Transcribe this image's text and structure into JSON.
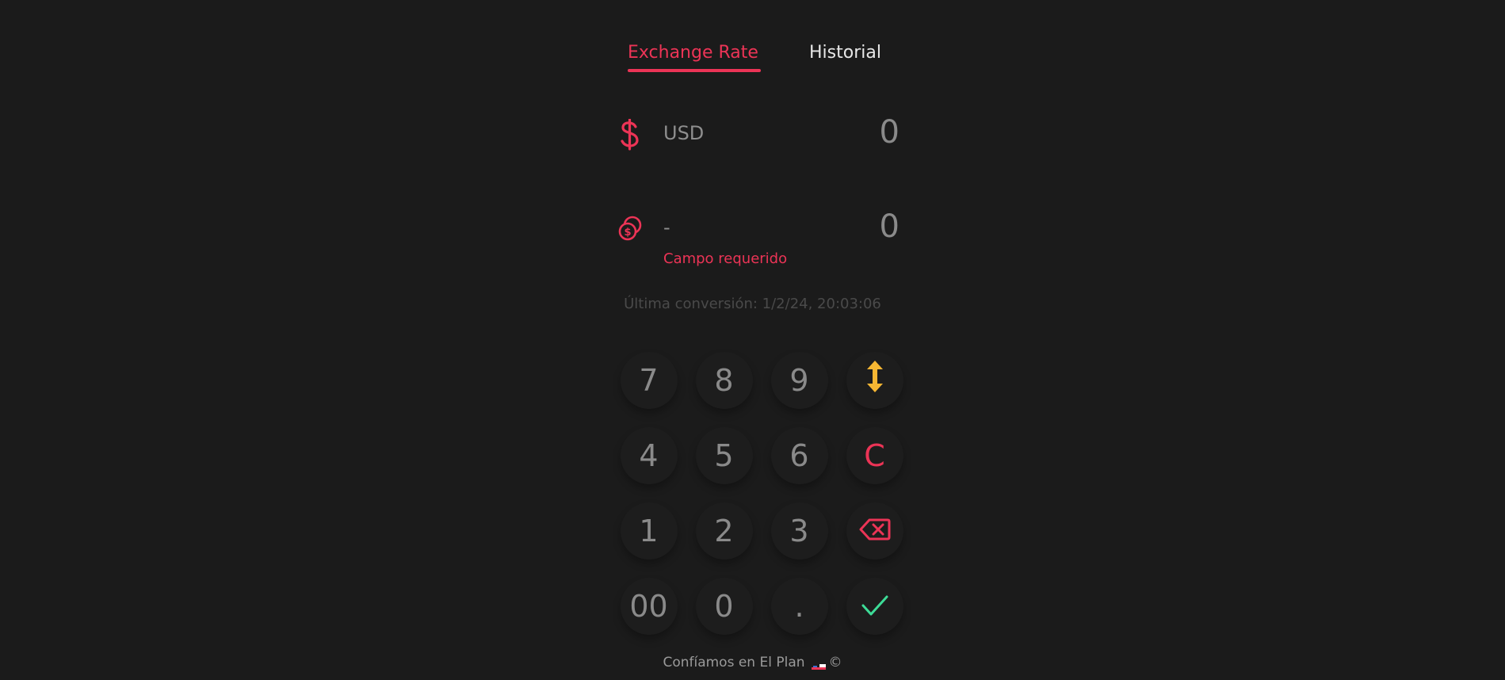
{
  "tabs": {
    "active": "Exchange Rate",
    "inactive": "Historial"
  },
  "converter": {
    "source": {
      "currency": "USD",
      "amount": "0",
      "icon": "dollar-icon"
    },
    "target": {
      "currency": "-",
      "amount": "0",
      "icon": "coins-icon"
    },
    "error": "Campo requerido",
    "last_conversion": "Última conversión: 1/2/24, 20:03:06"
  },
  "keypad": {
    "keys": [
      "7",
      "8",
      "9",
      "4",
      "5",
      "6",
      "1",
      "2",
      "3",
      "00",
      "0",
      "."
    ],
    "clear_label": "C",
    "swap_icon": "swap-vertical-icon",
    "backspace_icon": "backspace-icon",
    "confirm_icon": "check-icon"
  },
  "footer": {
    "text": "Confíamos en El Plan",
    "copyright": "©"
  },
  "colors": {
    "accent": "#ec3456",
    "swap": "#f7b733",
    "confirm": "#3ddc97",
    "background": "#1b1b1b"
  }
}
